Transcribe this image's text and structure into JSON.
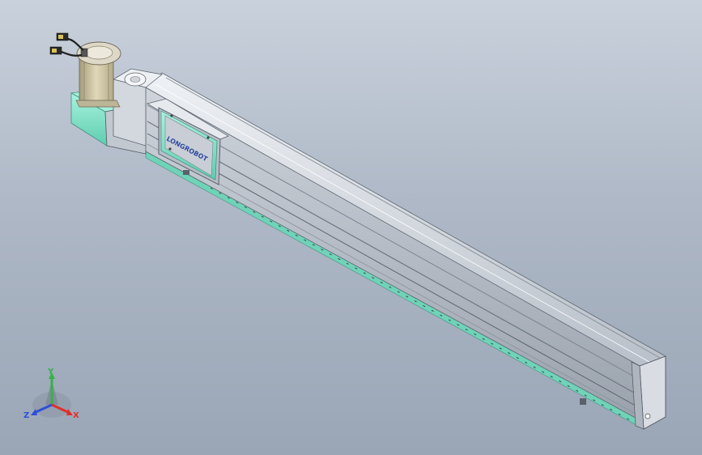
{
  "model": {
    "name": "linear-actuator-module",
    "carriage_logo_text": "LONGROBOT",
    "colors": {
      "background_top": "#c9d1dc",
      "background_bottom": "#9aa6b6",
      "rail_body": "#c4cad2",
      "rail_edge": "#e4e8ee",
      "rail_shadow": "#8c949e",
      "accent_green": "#7fe6cc",
      "motor_body": "#cfc6a4",
      "motor_cap": "#ddd8c8",
      "logo_blue": "#2d4aa0"
    }
  },
  "triad": {
    "x_label": "X",
    "y_label": "Y",
    "z_label": "Z",
    "x_color": "#e0302a",
    "y_color": "#36b24a",
    "z_color": "#2f4fd8"
  }
}
